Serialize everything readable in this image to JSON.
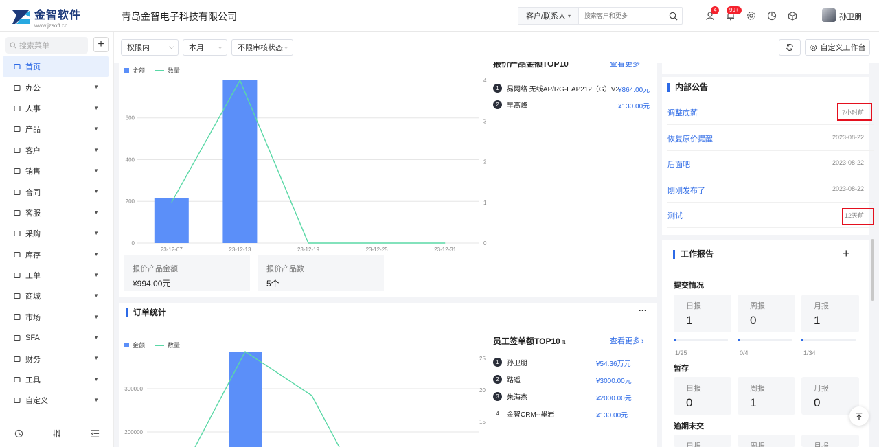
{
  "header": {
    "logo_name": "金智软件",
    "logo_url": "www.jzsoft.cn",
    "company": "青岛金智电子科技有限公司",
    "search_type": "客户/联系人",
    "search_placeholder": "搜索客户和更多",
    "badge_messages": "4",
    "badge_notifications": "99+",
    "username": "孙卫朋"
  },
  "sidebar": {
    "search_placeholder": "搜索菜单",
    "items": [
      {
        "label": "首页",
        "icon": "home-icon"
      },
      {
        "label": "办公",
        "icon": "briefcase-icon"
      },
      {
        "label": "人事",
        "icon": "people-icon"
      },
      {
        "label": "产品",
        "icon": "cube-icon"
      },
      {
        "label": "客户",
        "icon": "building-icon"
      },
      {
        "label": "销售",
        "icon": "layers-icon"
      },
      {
        "label": "合同",
        "icon": "document-icon"
      },
      {
        "label": "客服",
        "icon": "headset-icon"
      },
      {
        "label": "采购",
        "icon": "cart-icon"
      },
      {
        "label": "库存",
        "icon": "warehouse-icon"
      },
      {
        "label": "工单",
        "icon": "ticket-icon"
      },
      {
        "label": "商城",
        "icon": "shop-icon"
      },
      {
        "label": "市场",
        "icon": "market-icon"
      },
      {
        "label": "SFA",
        "icon": "sfa-icon"
      },
      {
        "label": "财务",
        "icon": "finance-icon"
      },
      {
        "label": "工具",
        "icon": "toolbox-icon"
      },
      {
        "label": "自定义",
        "icon": "grid-icon"
      }
    ]
  },
  "toolbar": {
    "scope": "权限内",
    "period": "本月",
    "audit": "不限审核状态",
    "customize": "自定义工作台"
  },
  "quote_card": {
    "legend_amount": "金额",
    "legend_count": "数量",
    "ranking_title": "报价产品金额TOP10",
    "more": "查看更多",
    "stat_amount_label": "报价产品金额",
    "stat_amount_value": "¥994.00元",
    "stat_count_label": "报价产品数",
    "stat_count_value": "5个",
    "ranking": [
      {
        "rank": "1",
        "name": "易网络 无线AP/RG-EAP212（G）V2...",
        "value": "¥864.00元"
      },
      {
        "rank": "2",
        "name": "早高峰",
        "value": "¥130.00元"
      }
    ]
  },
  "order_card": {
    "title": "订单统计",
    "legend_amount": "金额",
    "legend_count": "数量",
    "ranking_title": "员工签单额TOP10",
    "more": "查看更多",
    "ranking": [
      {
        "rank": "1",
        "name": "孙卫朋",
        "value": "¥54.36万元"
      },
      {
        "rank": "2",
        "name": "路遥",
        "value": "¥3000.00元"
      },
      {
        "rank": "3",
        "name": "朱海杰",
        "value": "¥2000.00元"
      },
      {
        "rank": "4",
        "name": "金智CRM--墨岩",
        "value": "¥130.00元"
      }
    ]
  },
  "announcements": {
    "title": "内部公告",
    "items": [
      {
        "title": "调整底薪",
        "date": "7小时前"
      },
      {
        "title": "恢复原价提醒",
        "date": "2023-08-22"
      },
      {
        "title": "后面吧",
        "date": "2023-08-22"
      },
      {
        "title": "刚刚发布了",
        "date": "2023-08-22"
      },
      {
        "title": "测试",
        "date": "12天前"
      }
    ]
  },
  "work_report": {
    "title": "工作报告",
    "submitted_label": "提交情况",
    "draft_label": "暂存",
    "overdue_label": "逾期未交",
    "daily": "日报",
    "weekly": "周报",
    "monthly": "月报",
    "submitted": {
      "daily": "1",
      "weekly": "0",
      "monthly": "1"
    },
    "submitted_progress": {
      "daily": "1/25",
      "weekly": "0/4",
      "monthly": "1/34"
    },
    "submitted_fraction": {
      "daily": 0.04,
      "weekly": 0.0,
      "monthly": 0.03
    },
    "draft": {
      "daily": "0",
      "weekly": "1",
      "monthly": "0"
    }
  },
  "chart_data": [
    {
      "type": "bar",
      "categories": [
        "23-12-07",
        "23-12-13",
        "23-12-19",
        "23-12-25",
        "23-12-31"
      ],
      "series": [
        {
          "name": "金额",
          "type": "bar",
          "values": [
            216,
            780,
            0,
            0,
            0
          ]
        },
        {
          "name": "数量",
          "type": "line",
          "values": [
            1,
            4,
            0,
            0,
            0
          ]
        }
      ],
      "y_left_ticks": [
        "0",
        "200",
        "400",
        "600"
      ],
      "y_right_ticks": [
        "0",
        "1",
        "2",
        "3",
        "4"
      ],
      "ylim_left": [
        0,
        780
      ],
      "ylim_right": [
        0,
        4
      ]
    },
    {
      "type": "bar",
      "categories": [],
      "series": [
        {
          "name": "金额",
          "type": "bar"
        },
        {
          "name": "数量",
          "type": "line"
        }
      ],
      "y_left_ticks": [
        "200000",
        "300000"
      ],
      "y_right_ticks": [
        "15",
        "20",
        "25"
      ]
    }
  ]
}
